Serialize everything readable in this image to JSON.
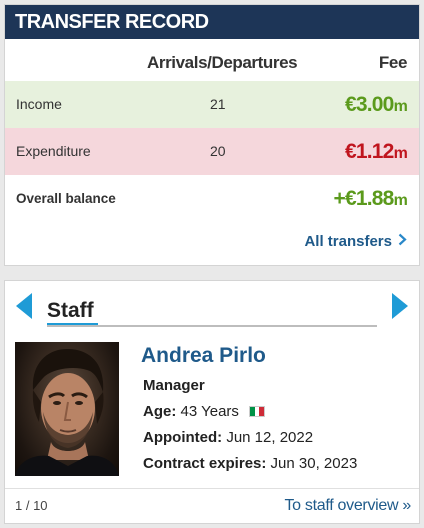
{
  "transfer_record": {
    "title": "TRANSFER RECORD",
    "columns": {
      "arrivals_departures": "Arrivals/Departures",
      "fee": "Fee"
    },
    "rows": [
      {
        "label": "Income",
        "count": "21",
        "fee_prefix": "€",
        "fee_value": "3.00",
        "fee_unit": "m",
        "color": "#5b9a1c"
      },
      {
        "label": "Expenditure",
        "count": "20",
        "fee_prefix": "€",
        "fee_value": "1.12",
        "fee_unit": "m",
        "color": "#c0151e"
      },
      {
        "label": "Overall balance",
        "count": "",
        "fee_prefix": "+€",
        "fee_value": "1.88",
        "fee_unit": "m",
        "color": "#5b9a1c"
      }
    ],
    "all_transfers_link": "All transfers",
    "link_chevron_icon": "chevron-right-icon"
  },
  "staff": {
    "title": "Staff",
    "prev_icon": "arrow-left-icon",
    "next_icon": "arrow-right-icon",
    "name": "Andrea Pirlo",
    "role": "Manager",
    "age_label": "Age:",
    "age_value": "43 Years",
    "nationality_flag": "italy-flag-icon",
    "appointed_label": "Appointed:",
    "appointed_value": "Jun 12, 2022",
    "contract_label": "Contract expires:",
    "contract_value": "Jun 30, 2023",
    "pager": "1 / 10",
    "overview_link": "To staff overview »"
  },
  "colors": {
    "header_bg": "#1d3557",
    "income_bg": "#e7f1dd",
    "expenditure_bg": "#f5d7dc",
    "accent_blue": "#1f9bd6",
    "link_blue": "#1f5a8a"
  }
}
